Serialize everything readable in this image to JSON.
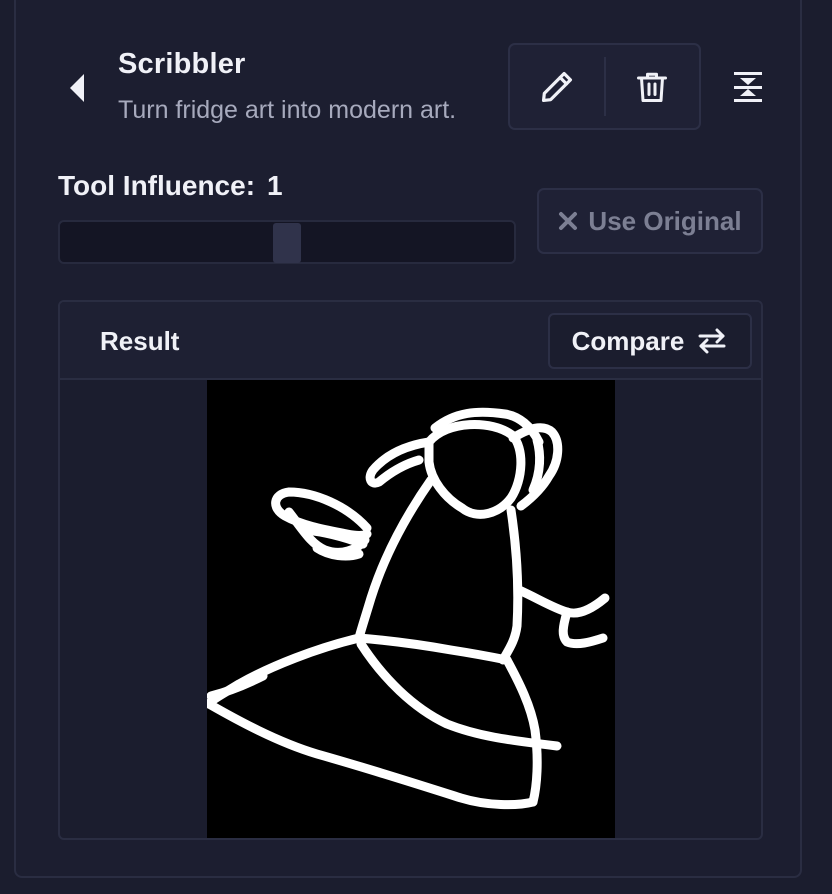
{
  "tool": {
    "title": "Scribbler",
    "description": "Turn fridge art into modern art."
  },
  "icons": {
    "back": "caret-left-icon",
    "edit": "pencil-icon",
    "delete": "trash-icon",
    "collapse": "collapse-vertical-icon",
    "close": "x-icon",
    "compare": "swap-arrows-icon"
  },
  "influence": {
    "label": "Tool Influence:",
    "value": "1",
    "slider_level": 0.5
  },
  "use_original": {
    "label": "Use Original",
    "enabled": false
  },
  "result": {
    "label": "Result",
    "compare_label": "Compare"
  },
  "colors": {
    "background": "#1b1d2e",
    "panel": "#1c1e30",
    "border": "#2a2d42",
    "text_primary": "#f0f1f7",
    "text_secondary": "#a7aabd",
    "text_disabled": "#7c7f93",
    "image_background": "#000000",
    "scribble": "#ffffff"
  }
}
